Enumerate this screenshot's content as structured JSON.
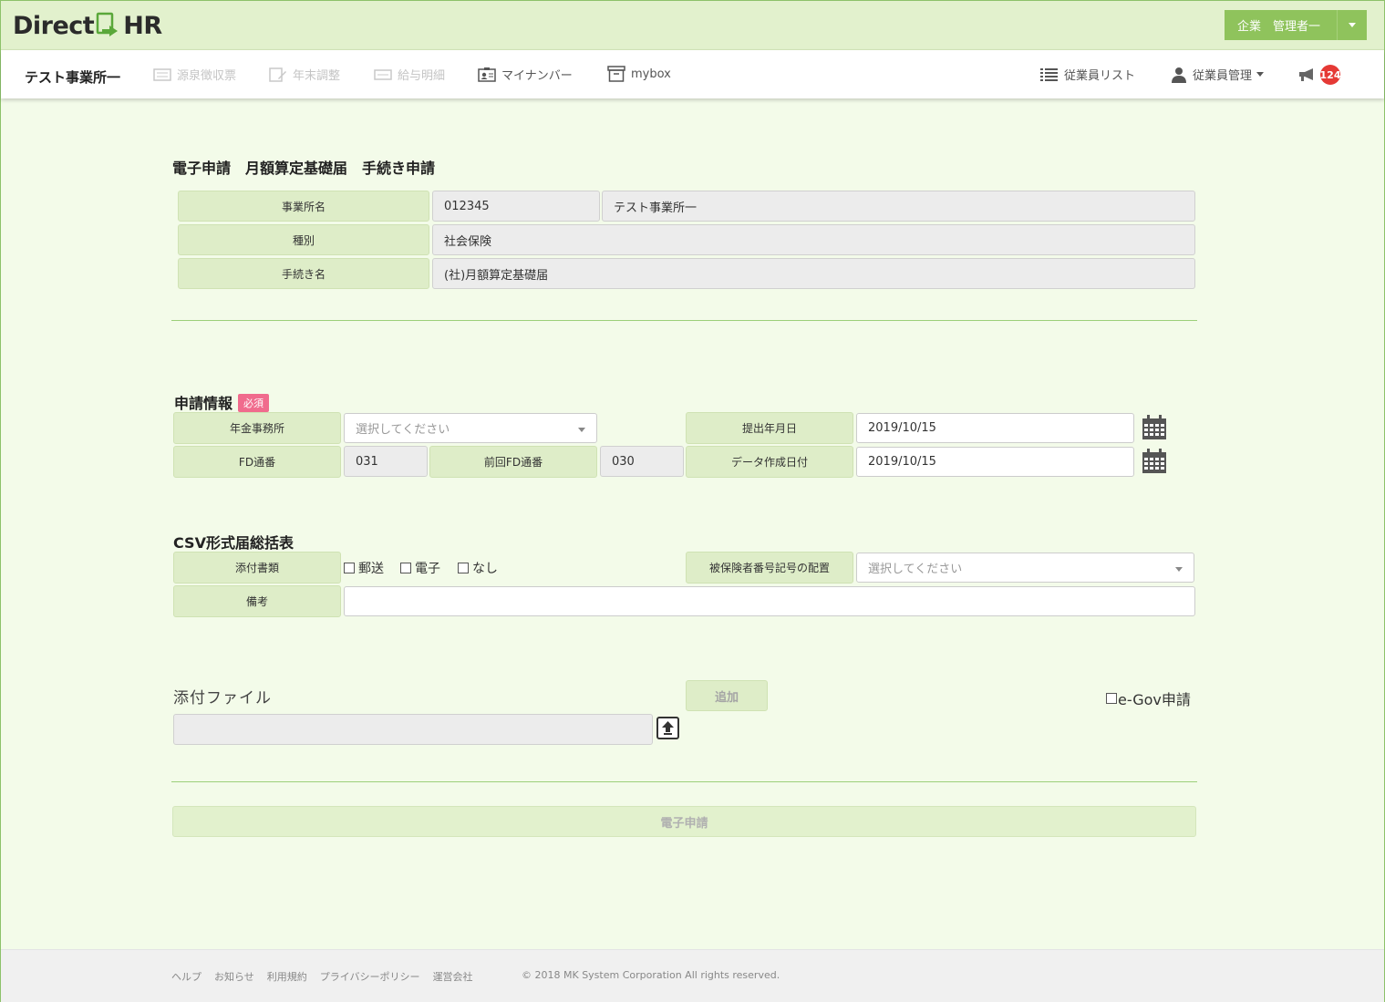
{
  "header": {
    "logo_left": "Direct",
    "logo_right": "HR",
    "user_label": "企業　管理者一"
  },
  "nav": {
    "office": "テスト事業所一",
    "items": [
      {
        "label": "源泉徴収票",
        "icon": "receipt-icon"
      },
      {
        "label": "年末調整",
        "icon": "edit-document-icon"
      },
      {
        "label": "給与明細",
        "icon": "payslip-icon"
      },
      {
        "label": "マイナンバー",
        "icon": "id-card-icon"
      },
      {
        "label": "mybox",
        "icon": "archive-box-icon"
      }
    ],
    "employee_list": "従業員リスト",
    "employee_mgmt": "従業員管理",
    "notification_count": "124"
  },
  "page": {
    "title": "電子申請　月額算定基礎届　手続き申請"
  },
  "info": {
    "office_label": "事業所名",
    "office_code": "012345",
    "office_name": "テスト事業所一",
    "type_label": "種別",
    "type_value": "社会保険",
    "procedure_label": "手続き名",
    "procedure_value": "(社)月額算定基礎届"
  },
  "application": {
    "section_title": "申請情報",
    "required": "必須",
    "pension_office_label": "年金事務所",
    "pension_office_placeholder": "選択してください",
    "submit_date_label": "提出年月日",
    "submit_date": "2019/10/15",
    "fd_label": "FD通番",
    "fd_value": "031",
    "prev_fd_label": "前回FD通番",
    "prev_fd_value": "030",
    "data_date_label": "データ作成日付",
    "data_date": "2019/10/15"
  },
  "csv": {
    "section_title": "CSV形式届総括表",
    "attach_label": "添付書類",
    "opt_mail": "郵送",
    "opt_electronic": "電子",
    "opt_none": "なし",
    "insured_label": "被保険者番号記号の配置",
    "insured_placeholder": "選択してください",
    "notes_label": "備考",
    "notes_value": ""
  },
  "attach": {
    "title": "添付ファイル",
    "add_button": "追加",
    "egov_label": "e-Gov申請"
  },
  "submit_button": "電子申請",
  "footer": {
    "links": [
      "ヘルプ",
      "お知らせ",
      "利用規約",
      "プライバシーポリシー",
      "運営会社"
    ],
    "copyright": "© 2018 MK System Corporation All rights reserved."
  },
  "colors": {
    "accent": "#8fc35c",
    "label_bg": "#deedc8",
    "badge": "#e53935",
    "required": "#f06b8d"
  }
}
